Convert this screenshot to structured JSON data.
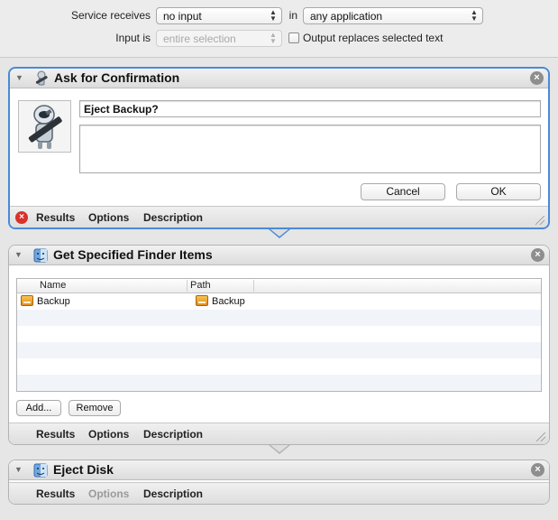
{
  "service": {
    "receives_label": "Service receives",
    "receives_value": "no input",
    "in_label": "in",
    "application_value": "any application",
    "input_is_label": "Input is",
    "input_is_value": "entire selection",
    "output_replaces_label": "Output replaces selected text",
    "output_replaces_checked": false
  },
  "actions": {
    "confirm": {
      "title": "Ask for Confirmation",
      "message": "Eject Backup?",
      "detail": "",
      "cancel_label": "Cancel",
      "ok_label": "OK",
      "status": "error",
      "footer": {
        "results": "Results",
        "options": "Options",
        "description": "Description"
      }
    },
    "finder": {
      "title": "Get Specified Finder Items",
      "columns": {
        "name": "Name",
        "path": "Path"
      },
      "rows": [
        {
          "name": "Backup",
          "path": "Backup"
        }
      ],
      "add_label": "Add...",
      "remove_label": "Remove",
      "footer": {
        "results": "Results",
        "options": "Options",
        "description": "Description"
      }
    },
    "eject": {
      "title": "Eject Disk",
      "footer": {
        "results": "Results",
        "options": "Options",
        "description": "Description"
      }
    }
  },
  "colors": {
    "selection_border": "#4a8ad8",
    "error": "#d8322b",
    "background": "#e6e6e6"
  }
}
